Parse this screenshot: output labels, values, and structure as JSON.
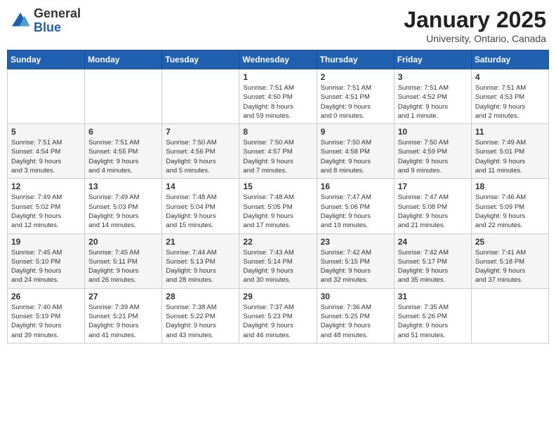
{
  "header": {
    "logo_general": "General",
    "logo_blue": "Blue",
    "month": "January 2025",
    "location": "University, Ontario, Canada"
  },
  "days_of_week": [
    "Sunday",
    "Monday",
    "Tuesday",
    "Wednesday",
    "Thursday",
    "Friday",
    "Saturday"
  ],
  "weeks": [
    [
      {
        "day": "",
        "info": ""
      },
      {
        "day": "",
        "info": ""
      },
      {
        "day": "",
        "info": ""
      },
      {
        "day": "1",
        "info": "Sunrise: 7:51 AM\nSunset: 4:50 PM\nDaylight: 8 hours\nand 59 minutes."
      },
      {
        "day": "2",
        "info": "Sunrise: 7:51 AM\nSunset: 4:51 PM\nDaylight: 9 hours\nand 0 minutes."
      },
      {
        "day": "3",
        "info": "Sunrise: 7:51 AM\nSunset: 4:52 PM\nDaylight: 9 hours\nand 1 minute."
      },
      {
        "day": "4",
        "info": "Sunrise: 7:51 AM\nSunset: 4:53 PM\nDaylight: 9 hours\nand 2 minutes."
      }
    ],
    [
      {
        "day": "5",
        "info": "Sunrise: 7:51 AM\nSunset: 4:54 PM\nDaylight: 9 hours\nand 3 minutes."
      },
      {
        "day": "6",
        "info": "Sunrise: 7:51 AM\nSunset: 4:55 PM\nDaylight: 9 hours\nand 4 minutes."
      },
      {
        "day": "7",
        "info": "Sunrise: 7:50 AM\nSunset: 4:56 PM\nDaylight: 9 hours\nand 5 minutes."
      },
      {
        "day": "8",
        "info": "Sunrise: 7:50 AM\nSunset: 4:57 PM\nDaylight: 9 hours\nand 7 minutes."
      },
      {
        "day": "9",
        "info": "Sunrise: 7:50 AM\nSunset: 4:58 PM\nDaylight: 9 hours\nand 8 minutes."
      },
      {
        "day": "10",
        "info": "Sunrise: 7:50 AM\nSunset: 4:59 PM\nDaylight: 9 hours\nand 9 minutes."
      },
      {
        "day": "11",
        "info": "Sunrise: 7:49 AM\nSunset: 5:01 PM\nDaylight: 9 hours\nand 11 minutes."
      }
    ],
    [
      {
        "day": "12",
        "info": "Sunrise: 7:49 AM\nSunset: 5:02 PM\nDaylight: 9 hours\nand 12 minutes."
      },
      {
        "day": "13",
        "info": "Sunrise: 7:49 AM\nSunset: 5:03 PM\nDaylight: 9 hours\nand 14 minutes."
      },
      {
        "day": "14",
        "info": "Sunrise: 7:48 AM\nSunset: 5:04 PM\nDaylight: 9 hours\nand 15 minutes."
      },
      {
        "day": "15",
        "info": "Sunrise: 7:48 AM\nSunset: 5:05 PM\nDaylight: 9 hours\nand 17 minutes."
      },
      {
        "day": "16",
        "info": "Sunrise: 7:47 AM\nSunset: 5:06 PM\nDaylight: 9 hours\nand 19 minutes."
      },
      {
        "day": "17",
        "info": "Sunrise: 7:47 AM\nSunset: 5:08 PM\nDaylight: 9 hours\nand 21 minutes."
      },
      {
        "day": "18",
        "info": "Sunrise: 7:46 AM\nSunset: 5:09 PM\nDaylight: 9 hours\nand 22 minutes."
      }
    ],
    [
      {
        "day": "19",
        "info": "Sunrise: 7:45 AM\nSunset: 5:10 PM\nDaylight: 9 hours\nand 24 minutes."
      },
      {
        "day": "20",
        "info": "Sunrise: 7:45 AM\nSunset: 5:11 PM\nDaylight: 9 hours\nand 26 minutes."
      },
      {
        "day": "21",
        "info": "Sunrise: 7:44 AM\nSunset: 5:13 PM\nDaylight: 9 hours\nand 28 minutes."
      },
      {
        "day": "22",
        "info": "Sunrise: 7:43 AM\nSunset: 5:14 PM\nDaylight: 9 hours\nand 30 minutes."
      },
      {
        "day": "23",
        "info": "Sunrise: 7:42 AM\nSunset: 5:15 PM\nDaylight: 9 hours\nand 32 minutes."
      },
      {
        "day": "24",
        "info": "Sunrise: 7:42 AM\nSunset: 5:17 PM\nDaylight: 9 hours\nand 35 minutes."
      },
      {
        "day": "25",
        "info": "Sunrise: 7:41 AM\nSunset: 5:18 PM\nDaylight: 9 hours\nand 37 minutes."
      }
    ],
    [
      {
        "day": "26",
        "info": "Sunrise: 7:40 AM\nSunset: 5:19 PM\nDaylight: 9 hours\nand 39 minutes."
      },
      {
        "day": "27",
        "info": "Sunrise: 7:39 AM\nSunset: 5:21 PM\nDaylight: 9 hours\nand 41 minutes."
      },
      {
        "day": "28",
        "info": "Sunrise: 7:38 AM\nSunset: 5:22 PM\nDaylight: 9 hours\nand 43 minutes."
      },
      {
        "day": "29",
        "info": "Sunrise: 7:37 AM\nSunset: 5:23 PM\nDaylight: 9 hours\nand 46 minutes."
      },
      {
        "day": "30",
        "info": "Sunrise: 7:36 AM\nSunset: 5:25 PM\nDaylight: 9 hours\nand 48 minutes."
      },
      {
        "day": "31",
        "info": "Sunrise: 7:35 AM\nSunset: 5:26 PM\nDaylight: 9 hours\nand 51 minutes."
      },
      {
        "day": "",
        "info": ""
      }
    ]
  ]
}
